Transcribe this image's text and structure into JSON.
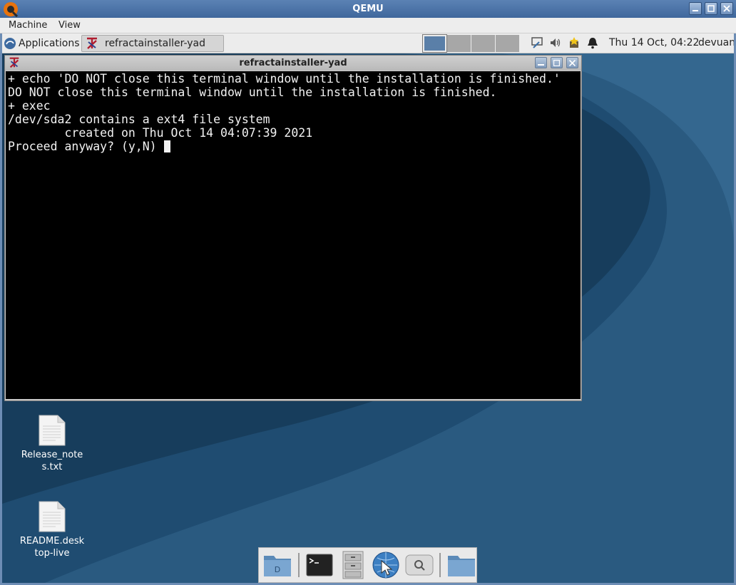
{
  "qemu": {
    "title": "QEMU",
    "menu": {
      "machine": "Machine",
      "view": "View"
    }
  },
  "panel": {
    "applications_label": "Applications",
    "task_label": "refractainstaller-yad",
    "clock": "Thu 14 Oct, 04:22",
    "user": "devuan",
    "tray_icons": [
      "network-icon",
      "volume-icon",
      "updates-icon",
      "notifications-icon"
    ]
  },
  "terminal_window": {
    "title": "refractainstaller-yad",
    "lines": [
      "+ echo 'DO NOT close this terminal window until the installation is finished.'",
      "DO NOT close this terminal window until the installation is finished.",
      "+ exec",
      "/dev/sda2 contains a ext4 file system",
      "        created on Thu Oct 14 04:07:39 2021",
      "Proceed anyway? (y,N) "
    ]
  },
  "desktop": {
    "icons": [
      {
        "label": "Release_notes.txt",
        "line1": "Release_note",
        "line2": "s.txt"
      },
      {
        "label": "README.desktop-live",
        "line1": "README.desk",
        "line2": "top-live"
      }
    ]
  },
  "dock": {
    "items": [
      "home-folder-icon",
      "terminal-icon",
      "file-cabinet-icon",
      "browser-icon",
      "search-icon",
      "folder-icon"
    ]
  },
  "colors": {
    "desktop_dark": "#173d5c",
    "desktop_light": "#2a5a80",
    "terminal_bg": "#000000",
    "terminal_fg": "#f2f2f2"
  }
}
